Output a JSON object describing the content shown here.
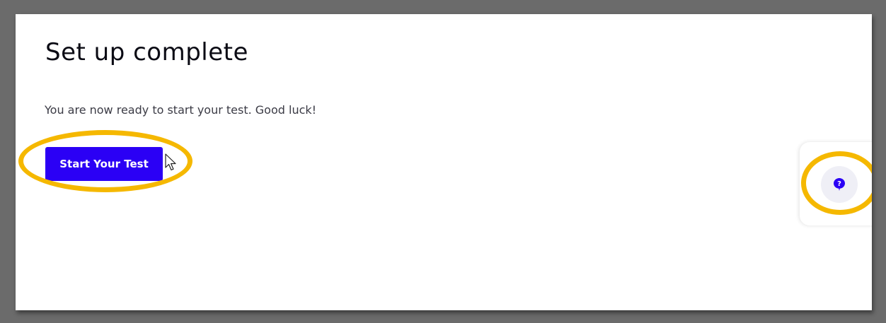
{
  "page": {
    "title": "Set up complete",
    "message": "You are now ready to start your test. Good luck!",
    "start_button_label": "Start Your Test"
  },
  "help": {
    "icon": "help-question-icon"
  },
  "colors": {
    "accent": "#2b00f5",
    "highlight": "#f5b800",
    "help_bg": "#efeff6"
  }
}
